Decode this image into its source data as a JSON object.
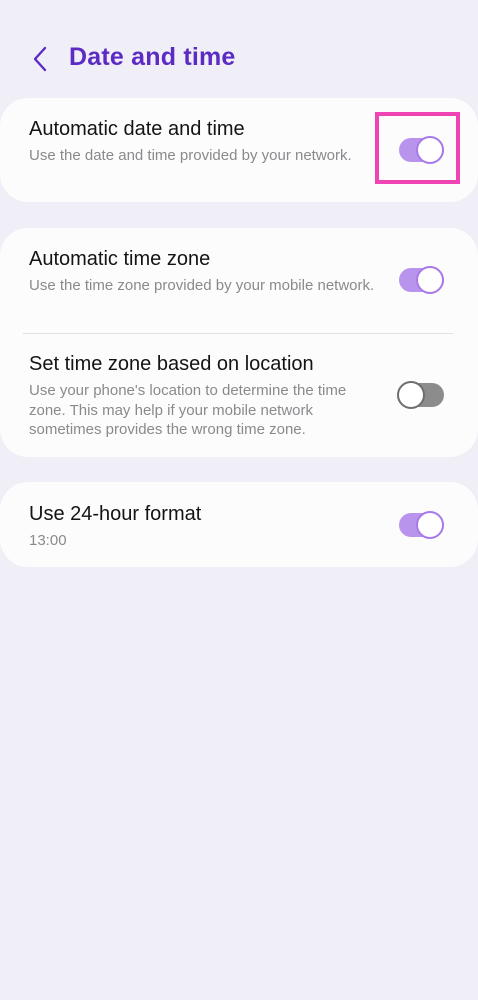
{
  "header": {
    "back_icon": "chevron-left-icon",
    "title": "Date and time"
  },
  "colors": {
    "accent": "#5b2bc4",
    "toggle_on": "#b894ec",
    "toggle_off": "#8c8c8c",
    "highlight": "#f043b6"
  },
  "settings": {
    "auto_date_time": {
      "title": "Automatic date and time",
      "subtitle": "Use the date and time provided by your network.",
      "enabled": true
    },
    "auto_time_zone": {
      "title": "Automatic time zone",
      "subtitle": "Use the time zone provided by your mobile network.",
      "enabled": true
    },
    "location_time_zone": {
      "title": "Set time zone based on location",
      "subtitle": "Use your phone's location to determine the time zone. This may help if your mobile network sometimes provides the wrong time zone.",
      "enabled": false
    },
    "format_24h": {
      "title": "Use 24-hour format",
      "subtitle": "13:00",
      "enabled": true
    }
  }
}
